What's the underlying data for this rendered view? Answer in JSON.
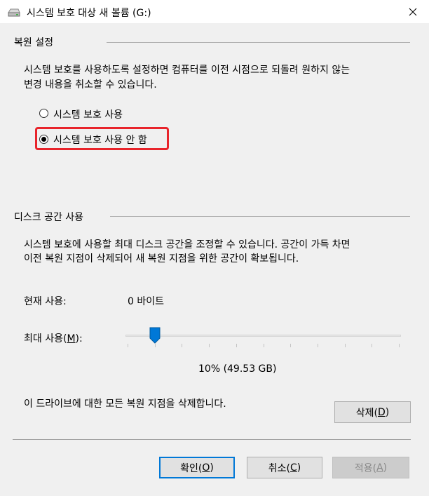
{
  "window": {
    "title": "시스템 보호 대상 새 볼륨 (G:)",
    "close_glyph": "✕"
  },
  "restore_settings": {
    "header": "복원 설정",
    "description_line1": "시스템 보호를 사용하도록 설정하면 컴퓨터를 이전 시점으로 되돌려 원하지 않는",
    "description_line2": "변경 내용을 취소할 수 있습니다.",
    "options": [
      {
        "label": "시스템 보호 사용",
        "selected": false
      },
      {
        "label": "시스템 보호 사용 안 함",
        "selected": true
      }
    ]
  },
  "disk_space": {
    "header": "디스크 공간 사용",
    "description_line1": "시스템 보호에 사용할 최대 디스크 공간을 조정할 수 있습니다. 공간이 가득 차면",
    "description_line2": "이전 복원 지점이 삭제되어 새 복원 지점을 위한 공간이 확보됩니다.",
    "current_usage_label": "현재 사용:",
    "current_usage_value": "0 바이트",
    "max_usage_label_prefix": "최대 사용(",
    "max_usage_label_key": "M",
    "max_usage_label_suffix": "):",
    "max_usage_percent": 10,
    "max_usage_text": "10% (49.53 GB)",
    "delete_description": "이 드라이브에 대한 모든 복원 지점을 삭제합니다.",
    "delete_button": {
      "prefix": "삭제(",
      "key": "D",
      "suffix": ")"
    }
  },
  "footer": {
    "ok_button": {
      "prefix": "확인(",
      "key": "O",
      "suffix": ")"
    },
    "cancel_button": {
      "prefix": "취소(",
      "key": "C",
      "suffix": ")"
    },
    "apply_button": {
      "prefix": "적용(",
      "key": "A",
      "suffix": ")",
      "enabled": false
    }
  },
  "colors": {
    "accent": "#0078d7",
    "highlight": "#e8242b"
  }
}
